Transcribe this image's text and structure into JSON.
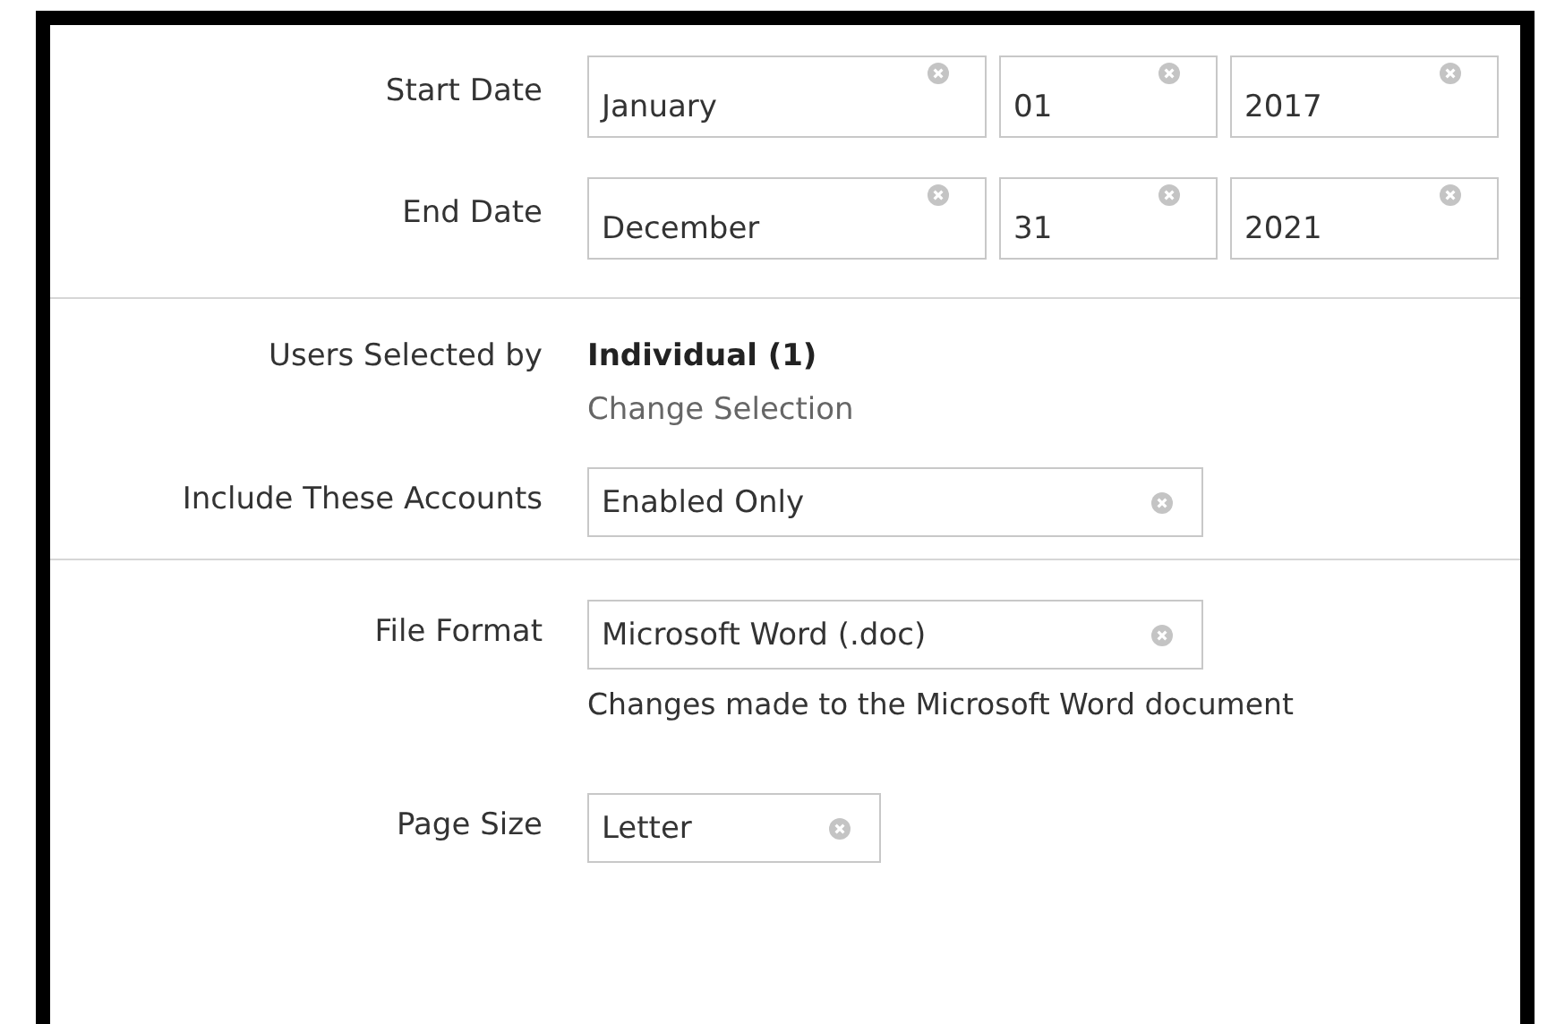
{
  "sections": [
    {
      "rows": [
        {
          "kind": "date",
          "label": "Start Date",
          "month": "January",
          "day": "01",
          "year": "2017"
        },
        {
          "kind": "date",
          "label": "End Date",
          "month": "December",
          "day": "31",
          "year": "2021"
        }
      ]
    },
    {
      "rows": [
        {
          "kind": "selection",
          "label": "Users Selected by",
          "value": "Individual (1)",
          "link": "Change Selection"
        },
        {
          "kind": "select",
          "label": "Include These Accounts",
          "value": "Enabled Only"
        }
      ]
    },
    {
      "rows": [
        {
          "kind": "select",
          "label": "File Format",
          "value": "Microsoft Word (.doc)",
          "note": "Changes made to the Microsoft Word document"
        },
        {
          "kind": "select",
          "label": "Page Size",
          "value": "Letter"
        }
      ]
    }
  ]
}
